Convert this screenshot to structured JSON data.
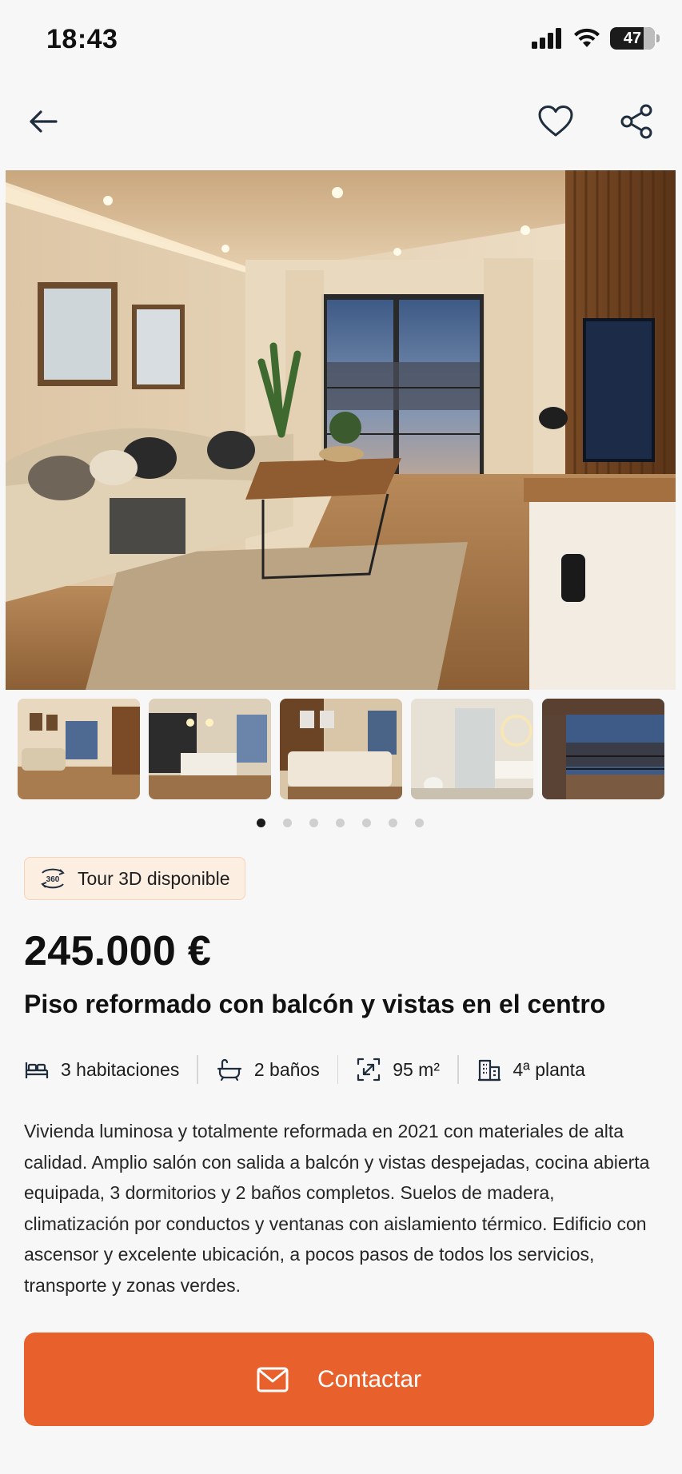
{
  "status_bar": {
    "time": "18:43",
    "battery": "47"
  },
  "nav": {
    "back_icon": "arrow-left-icon",
    "favorite_icon": "heart-icon",
    "share_icon": "share-icon"
  },
  "gallery": {
    "hero_alt": "Salón con balcón",
    "thumbnails": [
      "living-room",
      "kitchen",
      "bedroom",
      "bathroom",
      "balcony"
    ],
    "page_count": 7,
    "active_page": 1
  },
  "tour": {
    "icon": "360-icon",
    "label": "Tour 3D disponible"
  },
  "listing": {
    "price": "245.000 €",
    "title": "Piso reformado con balcón y vistas en el centro",
    "features": {
      "bedrooms": "3 habitaciones",
      "bathrooms": "2 baños",
      "area": "95 m²",
      "floor": "4ª planta"
    },
    "description": "Vivienda luminosa y totalmente reformada en 2021 con materiales de alta calidad. Amplio salón con salida a balcón y vistas despejadas, cocina abierta equipada, 3 dormitorios y 2 baños completos. Suelos de madera, climatización por conductos y ventanas con aislamiento térmico. Edificio con ascensor y excelente ubicación, a pocos pasos de todos los servicios, transporte y zonas verdes."
  },
  "contact": {
    "icon": "mail-icon",
    "label": "Contactar"
  },
  "colors": {
    "accent": "#e8612c",
    "badge_bg": "#fdeee2",
    "text": "#141414"
  }
}
